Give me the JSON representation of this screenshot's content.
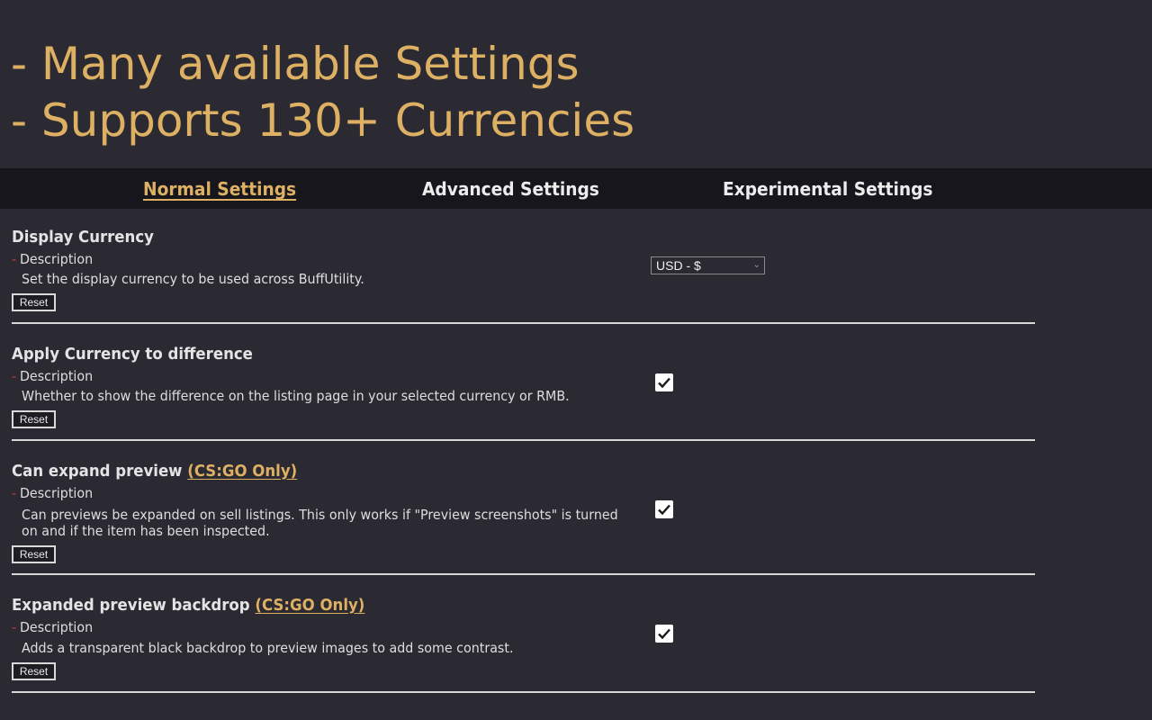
{
  "hero": {
    "line1": "- Many available Settings",
    "line2": "- Supports 130+ Currencies"
  },
  "tabs": [
    {
      "label": "Normal Settings",
      "active": true
    },
    {
      "label": "Advanced Settings",
      "active": false
    },
    {
      "label": "Experimental Settings",
      "active": false
    }
  ],
  "common": {
    "description_label": "Description",
    "reset_label": "Reset"
  },
  "settings": [
    {
      "title": "Display Currency",
      "tag": "",
      "description": "Set the display currency to be used across BuffUtility.",
      "control": "select",
      "value": "USD - $"
    },
    {
      "title": "Apply Currency to difference",
      "tag": "",
      "description": "Whether to show the difference on the listing page in your selected currency or RMB.",
      "control": "checkbox",
      "checked": true
    },
    {
      "title": "Can expand preview",
      "tag": "(CS:GO Only)",
      "description": "Can previews be expanded on sell listings. This only works if \"Preview screenshots\" is turned on and if the item has been inspected.",
      "control": "checkbox",
      "checked": true
    },
    {
      "title": "Expanded preview backdrop",
      "tag": "(CS:GO Only)",
      "description": "Adds a transparent black backdrop to preview images to add some contrast.",
      "control": "checkbox",
      "checked": true
    }
  ],
  "colors": {
    "background": "#2b2a33",
    "tabbar": "#17161d",
    "accent": "#ddb063",
    "dash": "#c23a3a"
  },
  "icons": {
    "checkmark": "checkmark-icon",
    "dropdown": "chevron-down-icon"
  }
}
